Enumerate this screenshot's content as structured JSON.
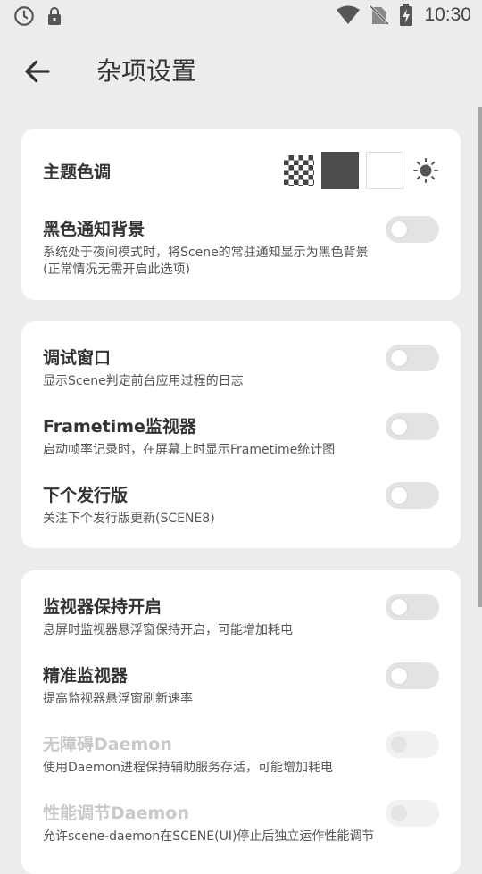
{
  "status": {
    "time": "10:30"
  },
  "header": {
    "title": "杂项设置"
  },
  "cards": [
    {
      "rows": [
        {
          "title": "主题色调"
        },
        {
          "title": "黑色通知背景",
          "desc_line1": "系统处于夜间模式时，将Scene的常驻通知显示为黑色背景",
          "desc_line2": "(正常情况无需开启此选项)",
          "enabled": false
        }
      ]
    },
    {
      "rows": [
        {
          "title": "调试窗口",
          "desc": "显示Scene判定前台应用过程的日志",
          "enabled": false
        },
        {
          "title": "Frametime监视器",
          "desc": "启动帧率记录时，在屏幕上时显示Frametime统计图",
          "enabled": false
        },
        {
          "title": "下个发行版",
          "desc": "关注下个发行版更新(SCENE8)",
          "enabled": false
        }
      ]
    },
    {
      "rows": [
        {
          "title": "监视器保持开启",
          "desc": "息屏时监视器悬浮窗保持开启，可能增加耗电",
          "enabled": false
        },
        {
          "title": "精准监视器",
          "desc": "提高监视器悬浮窗刷新速率",
          "enabled": false
        },
        {
          "title": "无障碍Daemon",
          "desc": "使用Daemon进程保持辅助服务存活，可能增加耗电",
          "enabled": false,
          "disabled": true
        },
        {
          "title": "性能调节Daemon",
          "desc": "允许scene-daemon在SCENE(UI)停止后独立运作性能调节",
          "enabled": false,
          "disabled": true
        }
      ]
    }
  ]
}
